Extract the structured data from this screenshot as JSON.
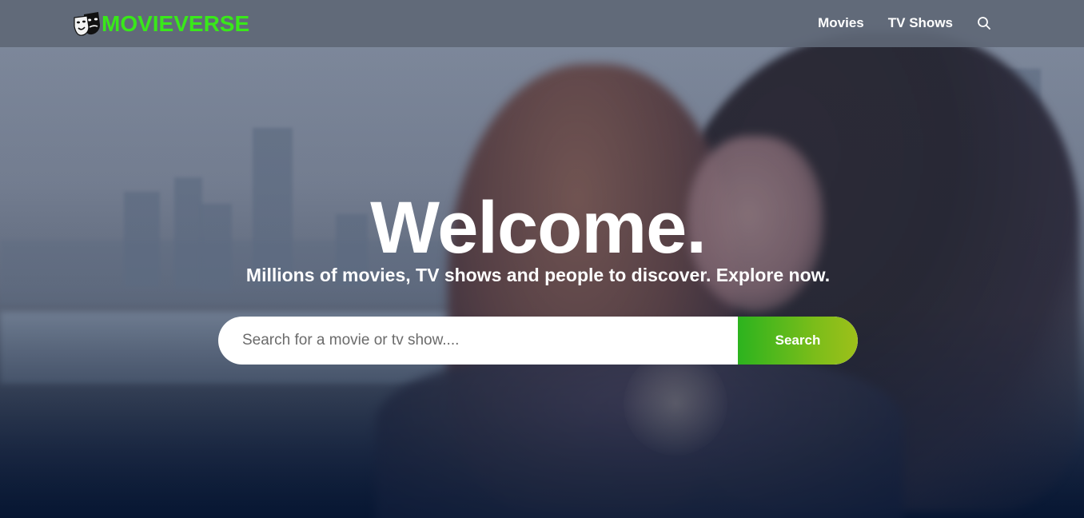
{
  "header": {
    "logo_text": "MOVIEVERSE",
    "nav": [
      {
        "label": "Movies"
      },
      {
        "label": "TV Shows"
      }
    ],
    "search_icon": "search-icon"
  },
  "hero": {
    "title": "Welcome.",
    "subtitle": "Millions of movies, TV shows and people to discover. Explore now.",
    "search": {
      "placeholder": "Search for a movie or tv show....",
      "value": "",
      "button_label": "Search"
    }
  },
  "colors": {
    "brand": "#39e81a",
    "header_bg": "#5e6776",
    "button_gradient_start": "#2cb31e",
    "button_gradient_end": "#9ec01a"
  }
}
